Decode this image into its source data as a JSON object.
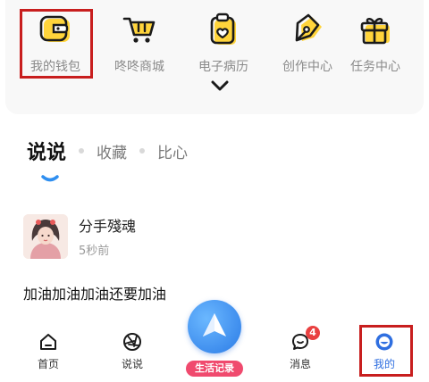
{
  "quick_actions": [
    {
      "label": "我的钱包",
      "icon": "wallet-icon"
    },
    {
      "label": "咚咚商城",
      "icon": "shopping-cart-icon"
    },
    {
      "label": "电子病历",
      "icon": "medical-record-icon"
    },
    {
      "label": "创作中心",
      "icon": "pen-nib-icon"
    },
    {
      "label": "任务中心",
      "icon": "gift-icon"
    }
  ],
  "tabs": [
    {
      "label": "说说",
      "active": true
    },
    {
      "label": "收藏",
      "active": false
    },
    {
      "label": "比心",
      "active": false
    }
  ],
  "post": {
    "username": "分手殘魂",
    "time": "5秒前",
    "content": "加油加油加油还要加油"
  },
  "bottom_nav": {
    "items": [
      {
        "label": "首页",
        "icon": "home-icon"
      },
      {
        "label": "说说",
        "icon": "aperture-icon"
      },
      {
        "label": "消息",
        "icon": "chat-bubble-icon",
        "badge": "4"
      },
      {
        "label": "我的",
        "icon": "profile-icon",
        "active": true
      }
    ],
    "center_button": {
      "tag": "生活记录",
      "icon": "paper-plane-icon"
    }
  },
  "colors": {
    "icon_yellow": "#ffd43b",
    "highlight_red": "#c81e1e",
    "accent_blue": "#2f6fe0",
    "badge_red": "#e94040",
    "tag_pink": "#f04a6e"
  }
}
